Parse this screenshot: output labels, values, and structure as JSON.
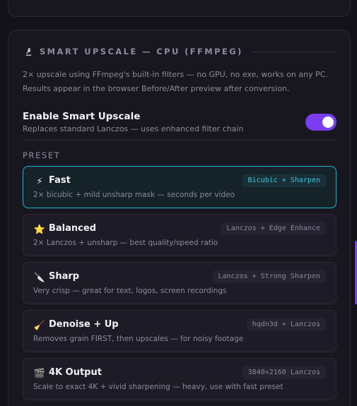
{
  "section": {
    "icon": "microscope-icon",
    "title": "SMART UPSCALE — CPU (FFMPEG)",
    "desc_line1": "2× upscale using FFmpeg's built-in filters — no GPU, no exe, works on any PC.",
    "desc_line2": "Results appear in the browser Before/After preview after conversion."
  },
  "toggle": {
    "title": "Enable Smart Upscale",
    "subtitle": "Replaces standard Lanczos — uses enhanced filter chain",
    "checked": true,
    "color": "#7a3df0"
  },
  "preset_label": "PRESET",
  "presets": [
    {
      "icon": "lightning-icon",
      "glyph": "⚡",
      "name": "Fast",
      "tag": "Bicubic + Sharpen",
      "desc": "2× bicubic + mild unsharp mask — seconds per video",
      "active": true
    },
    {
      "icon": "star-icon",
      "glyph": "⭐",
      "name": "Balanced",
      "tag": "Lanczos + Edge Enhance",
      "desc": "2× Lanczos + unsharp — best quality/speed ratio",
      "active": false
    },
    {
      "icon": "knife-icon",
      "glyph": "🔪",
      "name": "Sharp",
      "tag": "Lanczos + Strong Sharpen",
      "desc": "Very crisp — great for text, logos, screen recordings",
      "active": false
    },
    {
      "icon": "broom-icon",
      "glyph": "🧹",
      "name": "Denoise + Up",
      "tag": "hqdn3d + Lanczos",
      "desc": "Removes grain FIRST, then upscales — for noisy footage",
      "active": false
    },
    {
      "icon": "clapper-icon",
      "glyph": "🎬",
      "name": "4K Output",
      "tag": "3840×2160 Lanczos",
      "desc": "Scale to exact 4K + vivid sharpening — heavy, use with fast preset",
      "active": false
    }
  ],
  "colors": {
    "accent": "#7a3df0",
    "active_border": "#1fb6c9",
    "active_tag": "#38c6d8"
  }
}
